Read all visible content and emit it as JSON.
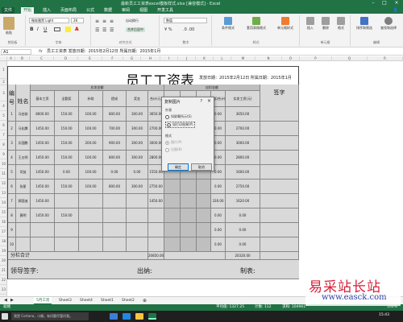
{
  "window": {
    "title": "最新员工工资表excel模板样式.xlsx [兼容模式] - Excel"
  },
  "tabs": [
    "文件",
    "开始",
    "插入",
    "页面布局",
    "公式",
    "数据",
    "审阅",
    "视图",
    "开发工具"
  ],
  "ribbon": {
    "paste": "粘贴",
    "clipboard": "剪贴板",
    "font_name": "微软雅黑 Light",
    "font_size": "28",
    "font_group": "字体",
    "align_group": "对齐方式",
    "wrap": "自动换行",
    "merge": "合并后居中",
    "number_format": "数值",
    "number_group": "数字",
    "cond_format": "条件格式",
    "table_format": "套用表格格式",
    "cell_style": "单元格样式",
    "styles_group": "样式",
    "insert": "插入",
    "delete": "删除",
    "format": "格式",
    "cells_group": "单元格",
    "sort": "排序和筛选",
    "find": "查找和选择",
    "edit_group": "编辑"
  },
  "formula_bar": {
    "name_box": "A1",
    "fx": "fx",
    "formula": "员工工资表   发放日期：2015年2月12日  所属日期：2015年1月"
  },
  "columns": [
    "A",
    "B",
    "C",
    "D",
    "E",
    "F",
    "G",
    "H",
    "I",
    "J",
    "K",
    "L",
    "M",
    "N",
    "O",
    "P",
    "Q",
    "R"
  ],
  "rows": [
    "1",
    "2",
    "3",
    "4",
    "5",
    "6",
    "7",
    "8",
    "9",
    "10",
    "11",
    "12",
    "13",
    "14",
    "15",
    "16",
    "17",
    "18",
    "19",
    "20",
    "21",
    "22",
    "23",
    "24",
    "25",
    "26",
    "27",
    "28",
    "29",
    "30",
    "31",
    "32"
  ],
  "sheet": {
    "title": "员工工资表",
    "date_info": "发放日期：2015年2月12日  所属日期：2015年1月",
    "h_no": "编号",
    "h_name": "姓名",
    "h_salary": "应发金额",
    "h_deduct": "应扣金额",
    "h_sign": "签字",
    "sub_headers": [
      "基本工资",
      "全勤奖",
      "补助",
      "提成",
      "奖金",
      "合计(元)",
      "迟到",
      "请假",
      "病假(元)",
      "应扣合计(元)",
      "实发工资(元)"
    ],
    "rows": [
      {
        "no": "1",
        "name": "马芸助",
        "v": [
          "8000.00",
          "150.00",
          "100.00",
          "800.00",
          "300.00",
          "3650.00",
          "",
          "",
          "",
          "0.00",
          "3650.00"
        ]
      },
      {
        "no": "2",
        "name": "马化腾",
        "v": [
          "1450.00",
          "150.00",
          "100.00",
          "700.00",
          "300.00",
          "2700.00",
          "",
          "",
          "",
          "0.00",
          "2700.00"
        ]
      },
      {
        "no": "3",
        "name": "乐国鹏",
        "v": [
          "1450.00",
          "150.00",
          "200.00",
          "900.00",
          "300.00",
          "3000.00",
          "",
          "",
          "",
          "0.00",
          "3000.00"
        ]
      },
      {
        "no": "4",
        "name": "王五明",
        "v": [
          "1450.00",
          "150.00",
          "100.00",
          "800.00",
          "300.00",
          "2800.00",
          "",
          "",
          "",
          "0.00",
          "2800.00"
        ]
      },
      {
        "no": "5",
        "name": "司徒",
        "v": [
          "1450.00",
          "0.00",
          "100.00",
          "0.00",
          "0.00",
          "1550.00",
          "",
          "",
          "",
          "0.00",
          "1600.00"
        ]
      },
      {
        "no": "6",
        "name": "张星",
        "v": [
          "1450.00",
          "150.00",
          "100.00",
          "800.00",
          "300.00",
          "2750.00",
          "",
          "",
          "",
          "0.00",
          "2750.00"
        ]
      },
      {
        "no": "7",
        "name": "郭国迪",
        "v": [
          "1450.00",
          "",
          "",
          "",
          "",
          "1450.00",
          "",
          "",
          "",
          "330.00",
          "1620.00"
        ]
      },
      {
        "no": "8",
        "name": "黄明",
        "v": [
          "1450.00",
          "150.00",
          "",
          "",
          "",
          "",
          "",
          "",
          "",
          "0.00",
          "0.00"
        ]
      },
      {
        "no": "9",
        "name": "",
        "v": [
          "",
          "",
          "",
          "",
          "",
          "",
          "",
          "",
          "",
          "0.00",
          "0.00"
        ]
      },
      {
        "no": "10",
        "name": "",
        "v": [
          "",
          "",
          "",
          "",
          "",
          "",
          "",
          "",
          "",
          "0.00",
          "0.00"
        ]
      }
    ],
    "subtotal_label": "分栏合计",
    "subtotal_value": "20850.00",
    "subtotal_net": "20320.00",
    "sign_leader": "领导签字:",
    "sign_cashier": "出纳:",
    "sign_maker": "制表:"
  },
  "dialog": {
    "title": "复制图片",
    "help": "?",
    "close": "×",
    "sec_appearance": "外观",
    "opt_screen": "如屏幕所示(S)",
    "opt_print": "如打印效果(P)",
    "sec_format": "格式",
    "opt_picture": "图片(P)",
    "opt_bitmap": "位图(B)",
    "ok": "确定",
    "cancel": "取消"
  },
  "sheet_tabs": [
    "5月工资",
    "Sheet3",
    "Sheet4",
    "Sheet1",
    "Sheet2"
  ],
  "status": {
    "ready": "就绪",
    "avg": "平均值: 1327.25",
    "count": "计数: 112",
    "sum": "求和: 104961",
    "zoom": "100%"
  },
  "taskbar": {
    "search": "我是 Cortana，小娜。有问题尽管问我。",
    "time": "15:43"
  },
  "watermark": {
    "line1": "易采站长站",
    "line2": "www.easck.com"
  },
  "colors": {
    "excel_green": "#217346",
    "taskbar": "#1f1f1f"
  }
}
